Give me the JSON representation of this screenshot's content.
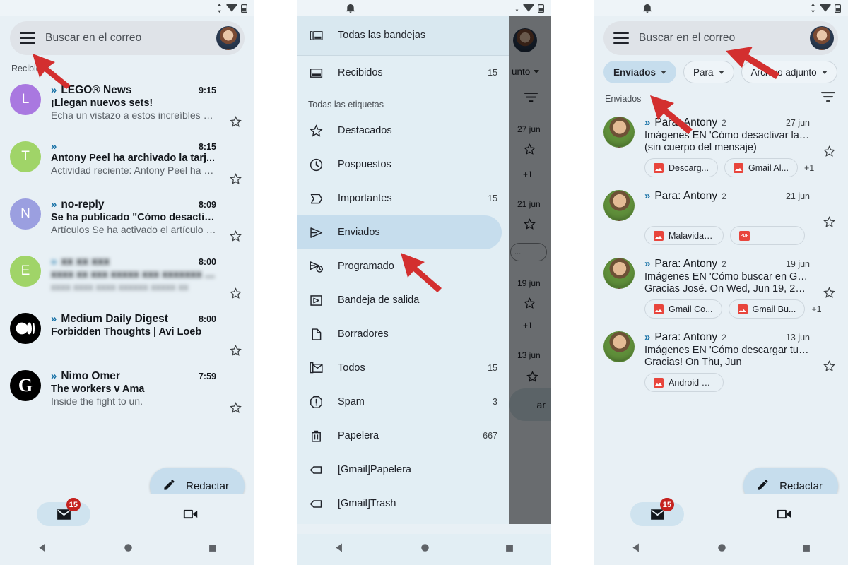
{
  "app": {
    "name": "Gmail",
    "accent_selected": "#c6dded",
    "panel_bg": "#e8f0f5",
    "badge_color": "#c5221f",
    "attachment_icon_color": "#e8453c",
    "arrow_color": "#d32f2f"
  },
  "statusbar": {
    "notification_icon": "bell-icon",
    "icons": [
      "sync-icon",
      "wifi-icon",
      "battery-icon"
    ]
  },
  "search": {
    "placeholder": "Buscar en el correo",
    "menu_icon": "hamburger-menu-icon",
    "avatar": "user-avatar"
  },
  "panel1": {
    "section_label": "Recibidos",
    "emails": [
      {
        "initial": "L",
        "color": "#a978e0",
        "sender": "LEGO® News",
        "subject": "¡Llegan nuevos sets!",
        "snippet": "Echa un vistazo a estos increíbles m...",
        "time": "9:15",
        "unread": true,
        "blurred": false
      },
      {
        "initial": "T",
        "color": "#a0d468",
        "sender": "",
        "subject": "Antony Peel ha archivado la tarj...",
        "snippet": "Actividad reciente: Antony Peel ha a...",
        "time": "8:15",
        "unread": true,
        "blurred": false
      },
      {
        "initial": "N",
        "color": "#9b9fe0",
        "sender": "no-reply",
        "subject": "Se ha publicado \"Cómo desactiv...",
        "snippet": "Artículos Se ha activado el artículo \"...",
        "time": "8:09",
        "unread": true,
        "blurred": false
      },
      {
        "initial": "E",
        "color": "#a0d468",
        "sender": "xx xx xxx",
        "subject": "xxxx xx xxx xxxxx xxx xxxxxxx xx xx",
        "snippet": "xxxx xxxx xxxx xxxxxx xxxxx xx",
        "time": "8:00",
        "unread": true,
        "blurred": true
      },
      {
        "initial": "M",
        "color": "#000000",
        "logo": "medium-logo",
        "sender": "Medium Daily Digest",
        "subject": "Forbidden Thoughts | Avi Loeb",
        "snippet": "",
        "time": "8:00",
        "unread": true,
        "blurred": false
      },
      {
        "initial": "G",
        "color": "#000000",
        "logo": "guardian-logo",
        "sender": "Nimo Omer",
        "subject": "The workers v Ama",
        "snippet": "Inside the fight to un.",
        "time": "7:59",
        "unread": true,
        "blurred": false
      }
    ],
    "compose_label": "Redactar"
  },
  "panel2": {
    "drawer": {
      "top_item": {
        "label": "Todas las bandejas",
        "icon": "all-inboxes-icon"
      },
      "inbox_item": {
        "label": "Recibidos",
        "icon": "inbox-icon",
        "count": "15"
      },
      "labels_header": "Todas las etiquetas",
      "items": [
        {
          "label": "Destacados",
          "icon": "star-icon",
          "count": ""
        },
        {
          "label": "Pospuestos",
          "icon": "clock-icon",
          "count": ""
        },
        {
          "label": "Importantes",
          "icon": "important-icon",
          "count": "15"
        },
        {
          "label": "Enviados",
          "icon": "send-icon",
          "count": "",
          "selected": true
        },
        {
          "label": "Programado",
          "icon": "scheduled-icon",
          "count": ""
        },
        {
          "label": "Bandeja de salida",
          "icon": "outbox-icon",
          "count": ""
        },
        {
          "label": "Borradores",
          "icon": "draft-icon",
          "count": ""
        },
        {
          "label": "Todos",
          "icon": "all-mail-icon",
          "count": "15"
        },
        {
          "label": "Spam",
          "icon": "spam-icon",
          "count": "3"
        },
        {
          "label": "Papelera",
          "icon": "trash-icon",
          "count": "667"
        },
        {
          "label": "[Gmail]Papelera",
          "icon": "label-icon",
          "count": ""
        },
        {
          "label": "[Gmail]Trash",
          "icon": "label-icon",
          "count": ""
        }
      ]
    },
    "behind": {
      "chip_text": "unto",
      "filter_icon": "filter-icon",
      "dates": [
        "27 jun",
        "21 jun",
        "19 jun",
        "13 jun"
      ],
      "plus_more": "+1",
      "truncated_chip": "...",
      "compose_partial": "ar"
    }
  },
  "panel3": {
    "filter_chips": [
      {
        "label": "Enviados",
        "selected": true,
        "icon": "chevron-down-icon"
      },
      {
        "label": "Para",
        "selected": false,
        "icon": "chevron-down-icon"
      },
      {
        "label": "Archivo adjunto",
        "selected": false,
        "icon": "chevron-down-icon"
      }
    ],
    "section_label": "Enviados",
    "filter_icon": "filter-icon",
    "emails": [
      {
        "sender": "Para: Antony",
        "count": "2",
        "subject": "Imágenes EN 'Cómo desactivar la d...",
        "snippet": "(sin cuerpo del mensaje)",
        "time": "27 jun",
        "attachments": [
          {
            "label": "Descarg...",
            "type": "image"
          },
          {
            "label": "Gmail Al...",
            "type": "image"
          }
        ],
        "more": "+1"
      },
      {
        "sender": "Para: Antony",
        "count": "2",
        "subject": "",
        "snippet": "",
        "time": "21 jun",
        "attachments": [
          {
            "label": "Malavida A...",
            "type": "image"
          },
          {
            "label": "",
            "type": "pdf"
          }
        ],
        "more": ""
      },
      {
        "sender": "Para: Antony",
        "count": "2",
        "subject": "Imágenes EN 'Cómo buscar en Gma...",
        "snippet": "Gracias José. On Wed, Jun 19, 2024...",
        "time": "19 jun",
        "attachments": [
          {
            "label": "Gmail Co...",
            "type": "image"
          },
          {
            "label": "Gmail Bu...",
            "type": "image"
          }
        ],
        "more": "+1"
      },
      {
        "sender": "Para: Antony",
        "count": "2",
        "subject": "Imágenes EN 'Cómo descargar tus...",
        "snippet": "Gracias! On Thu, Jun",
        "time": "13 jun",
        "attachments": [
          {
            "label": "Android G...",
            "type": "image"
          }
        ],
        "more": ""
      }
    ],
    "compose_label": "Redactar"
  },
  "bottomnav": {
    "mail_icon": "mail-icon",
    "mail_badge": "15",
    "meet_icon": "video-camera-icon"
  },
  "sysnav": {
    "back": "back-triangle-icon",
    "home": "home-circle-icon",
    "recents": "recents-square-icon"
  }
}
